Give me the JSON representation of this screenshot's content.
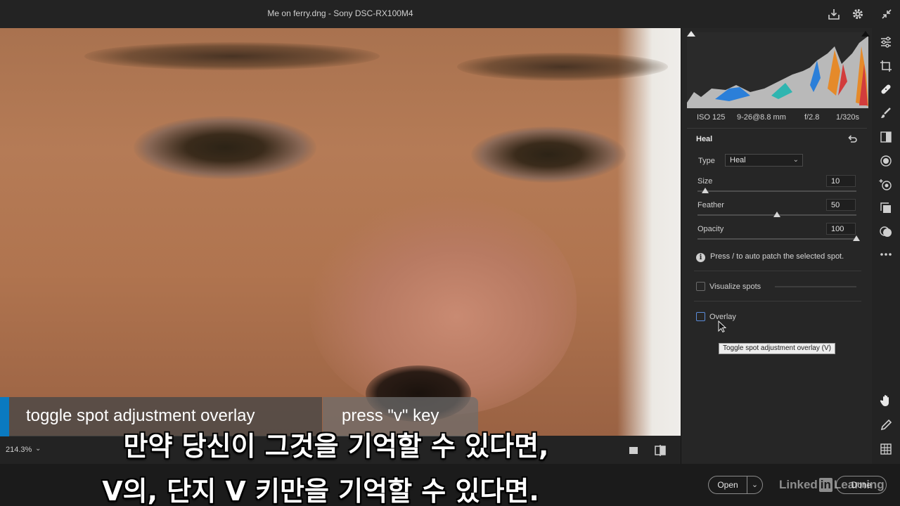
{
  "window": {
    "title": "Me on ferry.dng  -  Sony DSC-RX100M4"
  },
  "exif": {
    "iso": "ISO 125",
    "lens": "9-26@8.8 mm",
    "aperture": "f/2.8",
    "shutter": "1/320s"
  },
  "heal_panel": {
    "title": "Heal",
    "type_label": "Type",
    "type_value": "Heal",
    "size_label": "Size",
    "size_value": "10",
    "size_level": 0.05,
    "feather_label": "Feather",
    "feather_value": "50",
    "feather_level": 0.5,
    "opacity_label": "Opacity",
    "opacity_value": "100",
    "opacity_level": 1.0,
    "info_text": "Press / to auto patch the selected spot.",
    "visualize_label": "Visualize spots",
    "overlay_label": "Overlay",
    "tooltip": "Toggle spot adjustment overlay (V)"
  },
  "bottom_bar": {
    "zoom": "214.3%"
  },
  "footer": {
    "open_label": "Open",
    "done_label": "Done",
    "brand_pre": "Linked",
    "brand_in": "in",
    "brand_post": "Learning"
  },
  "lower_third": {
    "action": "toggle spot adjustment overlay",
    "shortcut": "press \"v\" key"
  },
  "subtitles": {
    "line1": "만약 당신이 그것을 기억할 수 있다면,",
    "line2": "V의, 단지 V 키만을 기억할 수 있다면."
  },
  "colors": {
    "accent": "#0a7ac0",
    "panel": "#262626",
    "checkbox_focus": "#5b8bd8"
  },
  "icons": [
    "export-icon",
    "gear-icon",
    "collapse-icon",
    "edit-sliders-icon",
    "crop-icon",
    "healing-icon",
    "brush-icon",
    "gradient-icon",
    "radial-icon",
    "red-eye-icon",
    "presets-icon",
    "snapshots-icon",
    "more-icon",
    "hand-icon",
    "color-sampler-icon",
    "grid-icon",
    "reset-icon",
    "info-icon",
    "chevron-down-icon"
  ]
}
